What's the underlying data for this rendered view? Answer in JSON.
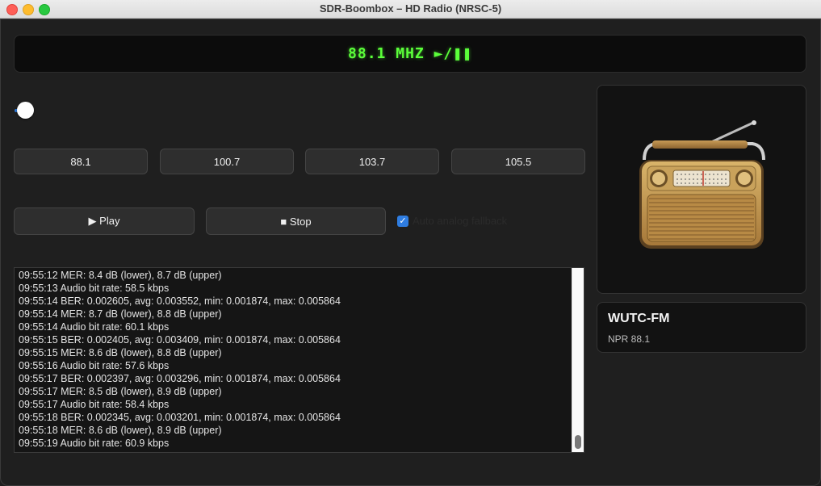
{
  "window": {
    "title": "SDR-Boombox – HD Radio (NRSC-5)"
  },
  "display": {
    "text": "88.1 MHZ ►/❚❚"
  },
  "presets": [
    "88.1",
    "100.7",
    "103.7",
    "105.5"
  ],
  "controls": {
    "play_label": "▶ Play",
    "stop_label": "■ Stop",
    "auto_fallback_label": "Auto analog fallback",
    "auto_fallback_checked": true
  },
  "log": {
    "lines": [
      "09:55:12 MER: 8.4 dB (lower), 8.7 dB (upper)",
      "09:55:13 Audio bit rate: 58.5 kbps",
      "09:55:14 BER: 0.002605, avg: 0.003552, min: 0.001874, max: 0.005864",
      "09:55:14 MER: 8.7 dB (lower), 8.8 dB (upper)",
      "09:55:14 Audio bit rate: 60.1 kbps",
      "09:55:15 BER: 0.002405, avg: 0.003409, min: 0.001874, max: 0.005864",
      "09:55:15 MER: 8.6 dB (lower), 8.8 dB (upper)",
      "09:55:16 Audio bit rate: 57.6 kbps",
      "09:55:17 BER: 0.002397, avg: 0.003296, min: 0.001874, max: 0.005864",
      "09:55:17 MER: 8.5 dB (lower), 8.9 dB (upper)",
      "09:55:17 Audio bit rate: 58.4 kbps",
      "09:55:18 BER: 0.002345, avg: 0.003201, min: 0.001874, max: 0.005864",
      "09:55:18 MER: 8.6 dB (lower), 8.9 dB (upper)",
      "09:55:19 Audio bit rate: 60.9 kbps"
    ]
  },
  "station": {
    "name": "WUTC-FM",
    "subtitle": "NPR 88.1"
  },
  "colors": {
    "display_green": "#5bff3a",
    "accent_blue": "#2f7de1"
  },
  "icons": {
    "album_art": "radio-icon"
  }
}
